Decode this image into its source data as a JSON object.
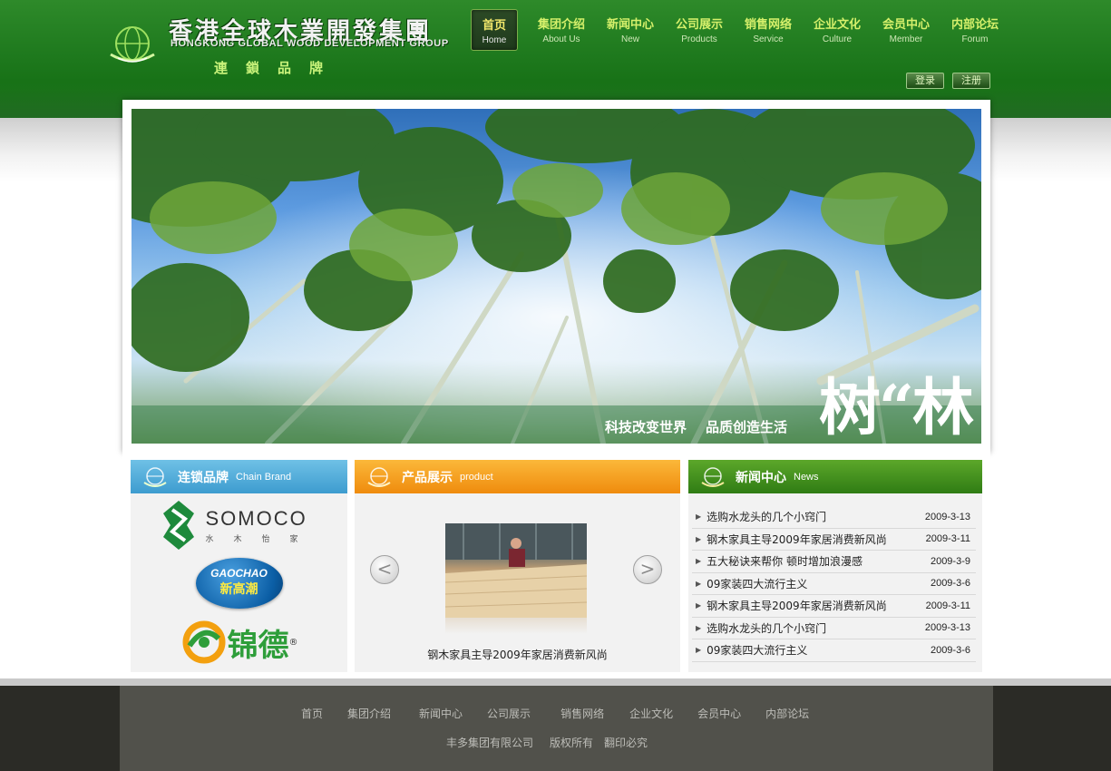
{
  "logo": {
    "cn": "香港全球木業開發集團",
    "en": "HONGKONG GLOBAL WOOD DEVELOPMENT GROUP",
    "slogan": "連鎖品牌"
  },
  "nav": [
    {
      "cn": "首页",
      "en": "Home",
      "active": true
    },
    {
      "cn": "集团介绍",
      "en": "About Us"
    },
    {
      "cn": "新闻中心",
      "en": "New"
    },
    {
      "cn": "公司展示",
      "en": "Products"
    },
    {
      "cn": "销售网络",
      "en": "Service"
    },
    {
      "cn": "企业文化",
      "en": "Culture"
    },
    {
      "cn": "会员中心",
      "en": "Member"
    },
    {
      "cn": "内部论坛",
      "en": "Forum"
    }
  ],
  "auth": {
    "login": "登录",
    "register": "注册"
  },
  "banner": {
    "slogan1": "科技改变世界",
    "slogan2": "品质创造生活",
    "big_text": "树“林"
  },
  "panels": {
    "brands": {
      "cn": "连锁品牌",
      "en": "Chain Brand"
    },
    "products": {
      "cn": "产品展示",
      "en": "product"
    },
    "news": {
      "cn": "新闻中心",
      "en": "News"
    }
  },
  "brands": {
    "somoco": {
      "name": "SOMOCO",
      "sub": "水木怡家"
    },
    "gaochao": {
      "en": "GAOCHAO",
      "cn": "新高潮"
    },
    "jinde": {
      "cn": "锦德",
      "reg": "®"
    }
  },
  "product": {
    "prev": "<",
    "next": ">",
    "caption": "钢木家具主导2009年家居消费新风尚"
  },
  "news": [
    {
      "title": "选购水龙头的几个小窍门",
      "date": "2009-3-13"
    },
    {
      "title": "钢木家具主导2009年家居消费新风尚",
      "date": "2009-3-11"
    },
    {
      "title": "五大秘诀来帮你  顿时增加浪漫感",
      "date": "2009-3-9"
    },
    {
      "title": "09家装四大流行主义",
      "date": "2009-3-6"
    },
    {
      "title": "钢木家具主导2009年家居消费新风尚",
      "date": "2009-3-11"
    },
    {
      "title": "选购水龙头的几个小窍门",
      "date": "2009-3-13"
    },
    {
      "title": "09家装四大流行主义",
      "date": "2009-3-6"
    }
  ],
  "footer": {
    "nav": [
      "首页",
      "集团介绍",
      "新闻中心",
      "公司展示",
      "销售网络",
      "企业文化",
      "会员中心",
      "内部论坛"
    ],
    "company": "丰多集团有限公司",
    "rights": "版权所有",
    "copy": "翻印必究"
  },
  "colors": {
    "header_green": "#1f7a1e",
    "nav_text": "#d6f06b",
    "brand_blue": "#3d9ccf",
    "product_orange": "#ef8b0d",
    "news_green": "#2f7c14",
    "footer_dark": "#2b2b26"
  }
}
